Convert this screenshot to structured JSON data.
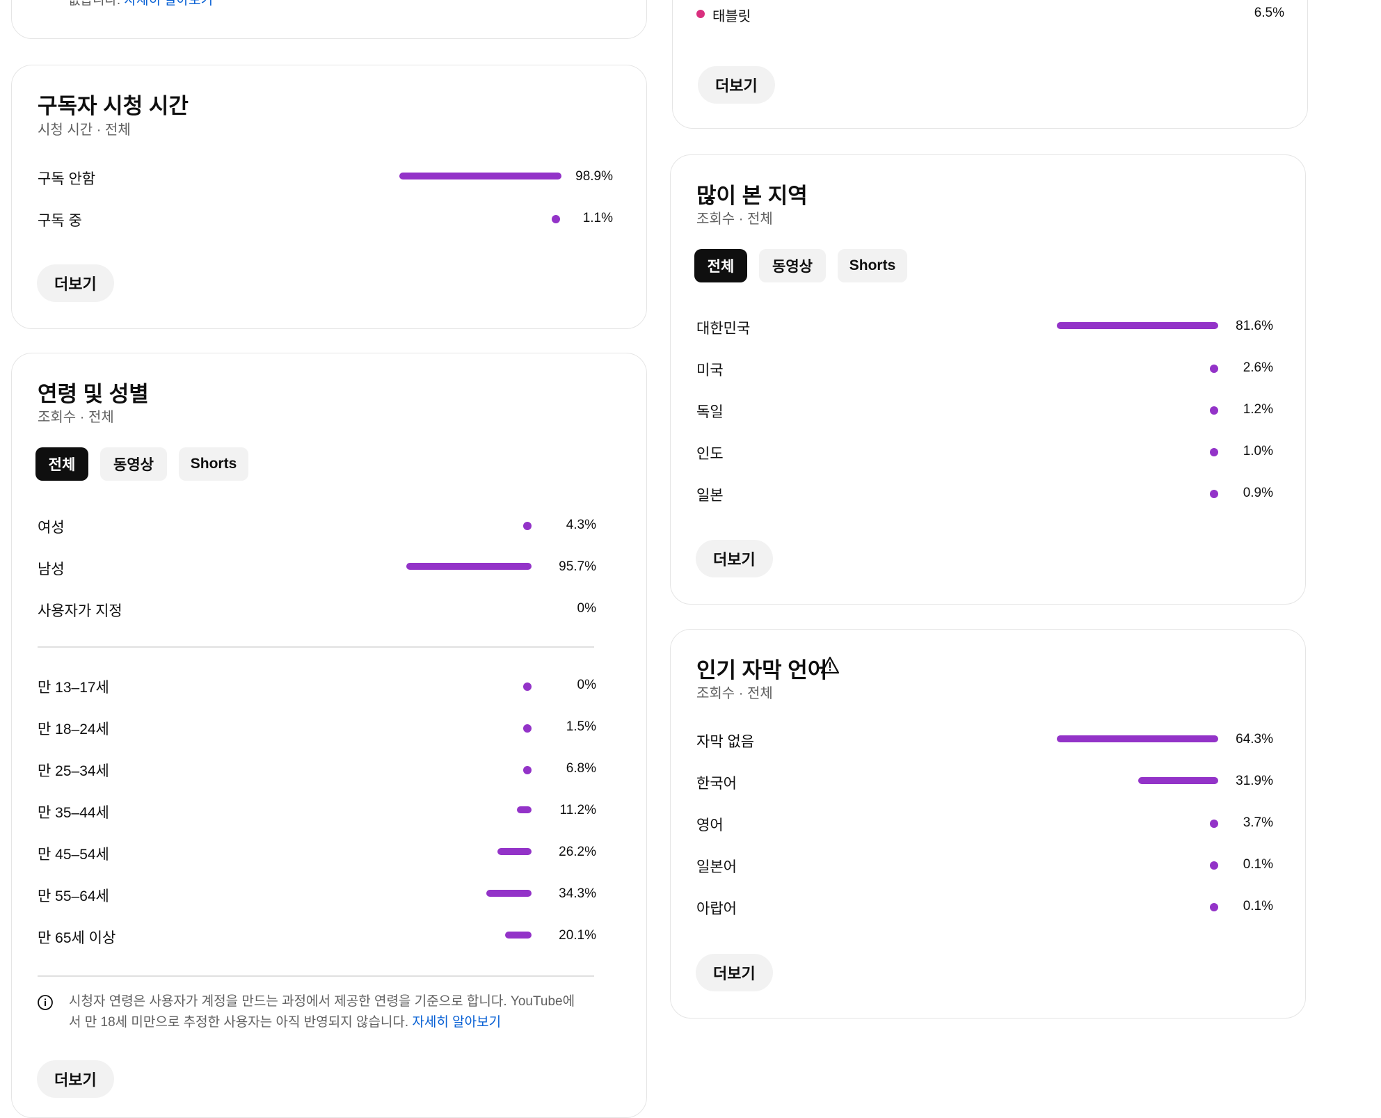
{
  "top_left_card": {
    "note_tail": "없습니다.",
    "learn_more": "자세히 알아보기"
  },
  "tablet_card": {
    "label": "태블릿",
    "value": "6.5%",
    "more": "더보기"
  },
  "subscriber_watch": {
    "title": "구독자 시청 시간",
    "subtitle": "시청 시간 · 전체",
    "rows": [
      {
        "label": "구독 안함",
        "value": "98.9%",
        "pct": 98.9
      },
      {
        "label": "구독 중",
        "value": "1.1%",
        "pct": 1.1
      }
    ],
    "more": "더보기"
  },
  "age_gender": {
    "title": "연령 및 성별",
    "subtitle": "조회수 · 전체",
    "tabs": [
      "전체",
      "동영상",
      "Shorts"
    ],
    "active_tab": "전체",
    "gender_rows": [
      {
        "label": "여성",
        "value": "4.3%",
        "pct": 4.3
      },
      {
        "label": "남성",
        "value": "95.7%",
        "pct": 95.7
      },
      {
        "label": "사용자가 지정",
        "value": "0%",
        "pct": 0
      }
    ],
    "age_rows": [
      {
        "label": "만 13–17세",
        "value": "0%",
        "pct": 0
      },
      {
        "label": "만 18–24세",
        "value": "1.5%",
        "pct": 1.5
      },
      {
        "label": "만 25–34세",
        "value": "6.8%",
        "pct": 6.8
      },
      {
        "label": "만 35–44세",
        "value": "11.2%",
        "pct": 11.2
      },
      {
        "label": "만 45–54세",
        "value": "26.2%",
        "pct": 26.2
      },
      {
        "label": "만 55–64세",
        "value": "34.3%",
        "pct": 34.3
      },
      {
        "label": "만 65세 이상",
        "value": "20.1%",
        "pct": 20.1
      }
    ],
    "note_line1": "시청자 연령은 사용자가 계정을 만드는 과정에서 제공한 연령을 기준으로 합니다. YouTube에",
    "note_line2": "서 만 18세 미만으로 추정한 사용자는 아직 반영되지 않습니다.",
    "learn_more": "자세히 알아보기",
    "more": "더보기"
  },
  "top_geographies": {
    "title": "많이 본 지역",
    "subtitle": "조회수 · 전체",
    "tabs": [
      "전체",
      "동영상",
      "Shorts"
    ],
    "active_tab": "전체",
    "rows": [
      {
        "label": "대한민국",
        "value": "81.6%",
        "pct": 81.6
      },
      {
        "label": "미국",
        "value": "2.6%",
        "pct": 2.6
      },
      {
        "label": "독일",
        "value": "1.2%",
        "pct": 1.2
      },
      {
        "label": "인도",
        "value": "1.0%",
        "pct": 1.0
      },
      {
        "label": "일본",
        "value": "0.9%",
        "pct": 0.9
      }
    ],
    "more": "더보기"
  },
  "subtitle_languages": {
    "title": "인기 자막 언어",
    "subtitle": "조회수 · 전체",
    "warning_icon": "warning-icon",
    "rows": [
      {
        "label": "자막 없음",
        "value": "64.3%",
        "pct": 64.3
      },
      {
        "label": "한국어",
        "value": "31.9%",
        "pct": 31.9
      },
      {
        "label": "영어",
        "value": "3.7%",
        "pct": 3.7
      },
      {
        "label": "일본어",
        "value": "0.1%",
        "pct": 0.1
      },
      {
        "label": "아랍어",
        "value": "0.1%",
        "pct": 0.1
      }
    ],
    "more": "더보기"
  },
  "colors": {
    "bar": "#9333c8",
    "tablet_dot": "#d92f7e",
    "link": "#065fd4"
  }
}
